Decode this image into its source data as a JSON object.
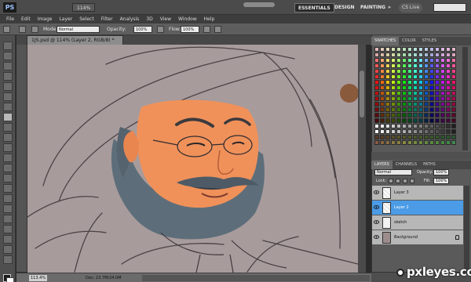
{
  "app": {
    "logo": "PS",
    "zoom_level": "114%",
    "workspaces": [
      "ESSENTIALS",
      "DESIGN",
      "PAINTING",
      "»"
    ],
    "cs_live": "CS Live"
  },
  "menu": [
    "File",
    "Edit",
    "Image",
    "Layer",
    "Select",
    "Filter",
    "Analysis",
    "3D",
    "View",
    "Window",
    "Help"
  ],
  "options_bar": {
    "mode_label": "Mode:",
    "mode_value": "Normal",
    "opacity_label": "Opacity:",
    "opacity_value": "100%",
    "flow_label": "Flow:",
    "flow_value": "100%"
  },
  "document": {
    "tab_title": "1JS.psd @ 114% (Layer 2, RGB/8) *",
    "status_zoom": "113.4%",
    "status_doc": "Doc: 23.7M/24.0M"
  },
  "swatches_panel": {
    "tabs": [
      "SWATCHES",
      "COLOR",
      "STYLES"
    ],
    "active": "SWATCHES"
  },
  "layers_panel": {
    "tabs": [
      "LAYERS",
      "CHANNELS",
      "PATHS"
    ],
    "active": "LAYERS",
    "blend_mode": "Normal",
    "opacity_label": "Opacity:",
    "opacity_value": "100%",
    "lock_label": "Lock:",
    "fill_label": "Fill:",
    "fill_value": "100%",
    "layers": [
      {
        "name": "Layer 3",
        "selected": false,
        "italic": false,
        "thumb": "checker"
      },
      {
        "name": "Layer 2",
        "selected": true,
        "italic": false,
        "thumb": "checker"
      },
      {
        "name": "sketch",
        "selected": false,
        "italic": false,
        "thumb": "plain"
      },
      {
        "name": "Background",
        "selected": false,
        "italic": true,
        "thumb": "dark"
      }
    ]
  },
  "watermark": "pxleyes.com",
  "colors": {
    "canvas_bg": "#a89b9c",
    "skin": "#f0915a",
    "beard": "#5d6e7a",
    "selected_layer": "#4b9be6"
  }
}
